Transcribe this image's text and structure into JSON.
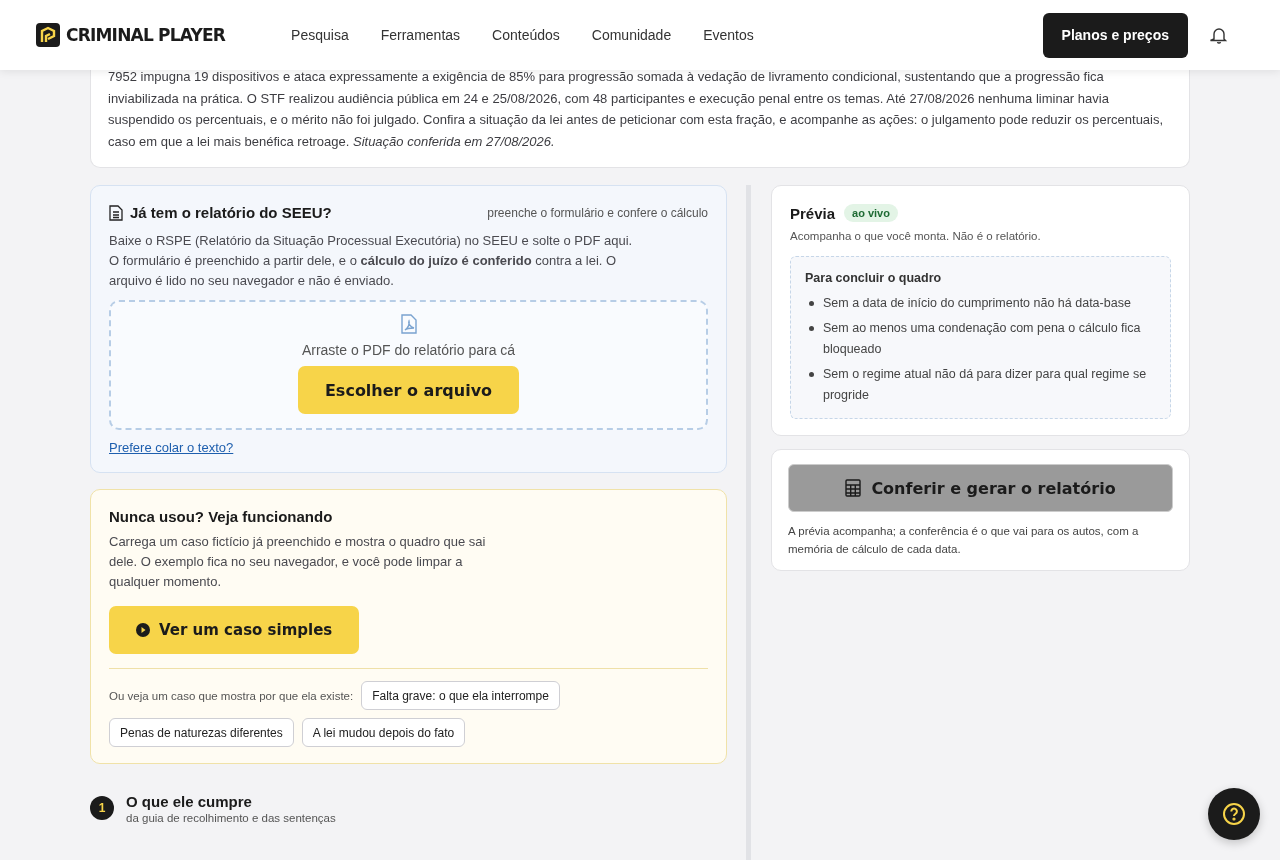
{
  "header": {
    "logo": "CRIMINAL PLAYER",
    "nav": [
      {
        "label": "Pesquisa"
      },
      {
        "label": "Ferramentas"
      },
      {
        "label": "Conteúdos"
      },
      {
        "label": "Comunidade"
      },
      {
        "label": "Eventos"
      }
    ],
    "cta": "Planos e preços"
  },
  "notice": {
    "text": "7952 impugna 19 dispositivos e ataca expressamente a exigência de 85% para progressão somada à vedação de livramento condicional, sustentando que a progressão fica inviabilizada na prática. O STF realizou audiência pública em 24 e 25/08/2026, com 48 participantes e execução penal entre os temas. Até 27/08/2026 nenhuma liminar havia suspendido os percentuais, e o mérito não foi julgado. Confira a situação da lei antes de peticionar com esta fração, e acompanhe as ações: o julgamento pode reduzir os percentuais, caso em que a lei mais benéfica retroage. *Situação conferida em 27/08/2026.*"
  },
  "upload": {
    "title": "Já tem o relatório do SEEU?",
    "hint": "preenche o formulário e confere o cálculo",
    "text": "Baixe o RSPE (Relatório da Situação Processual Executória) no SEEU e solte o PDF aqui. O formulário é preenchido a partir dele, e o **cálculo do juízo é conferido** contra a lei. O arquivo é lido no seu navegador e não é enviado.",
    "drop_label": "Arraste o PDF do relatório para cá",
    "button": "Escolher o arquivo",
    "link": "Prefere colar o texto?"
  },
  "demo": {
    "title": "Nunca usou? Veja funcionando",
    "text": "Carrega um caso fictício já preenchido e mostra o quadro que sai dele. O exemplo fica no seu navegador, e você pode limpar a qualquer momento.",
    "button": "Ver um caso simples",
    "cases_label": "Ou veja um caso que mostra por que ela existe:",
    "cases": [
      {
        "label": "Falta grave: o que ela interrompe"
      },
      {
        "label": "Penas de naturezas diferentes"
      },
      {
        "label": "A lei mudou depois do fato"
      }
    ]
  },
  "step": {
    "number": "1",
    "title": "O que ele cumpre",
    "subtitle": "da guia de recolhimento e das sentenças"
  },
  "preview": {
    "title": "Prévia",
    "badge": "ao vivo",
    "subtitle": "Acompanha o que você monta. Não é o relatório.",
    "todo_title": "Para concluir o quadro",
    "todo": [
      "Sem a data de início do cumprimento não há data-base",
      "Sem ao menos uma condenação com pena o cálculo fica bloqueado",
      "Sem o regime atual não dá para dizer para qual regime se progride"
    ]
  },
  "generate": {
    "button": "Conferir e gerar o relatório",
    "disabled": true,
    "note": "A prévia acompanha; a conferência é o que vai para os autos, com a memória de cálculo de cada data."
  }
}
